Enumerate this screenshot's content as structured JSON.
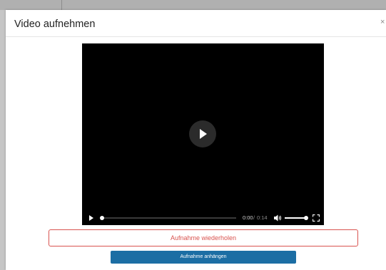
{
  "modal": {
    "title": "Video aufnehmen",
    "close_label": "×"
  },
  "player": {
    "current_time": "0:00",
    "separator": "/",
    "total_time": "0:14",
    "progress_fraction": 0.0,
    "volume_fraction": 1.0,
    "icons": [
      "play-icon",
      "volume-icon",
      "fullscreen-icon"
    ]
  },
  "actions": {
    "retry_label": "Aufnahme wiederholen",
    "attach_label": "Aufnahme anhängen"
  },
  "colors": {
    "danger": "#d9534f",
    "primary": "#1c6ea4",
    "player_bg": "#000000"
  }
}
